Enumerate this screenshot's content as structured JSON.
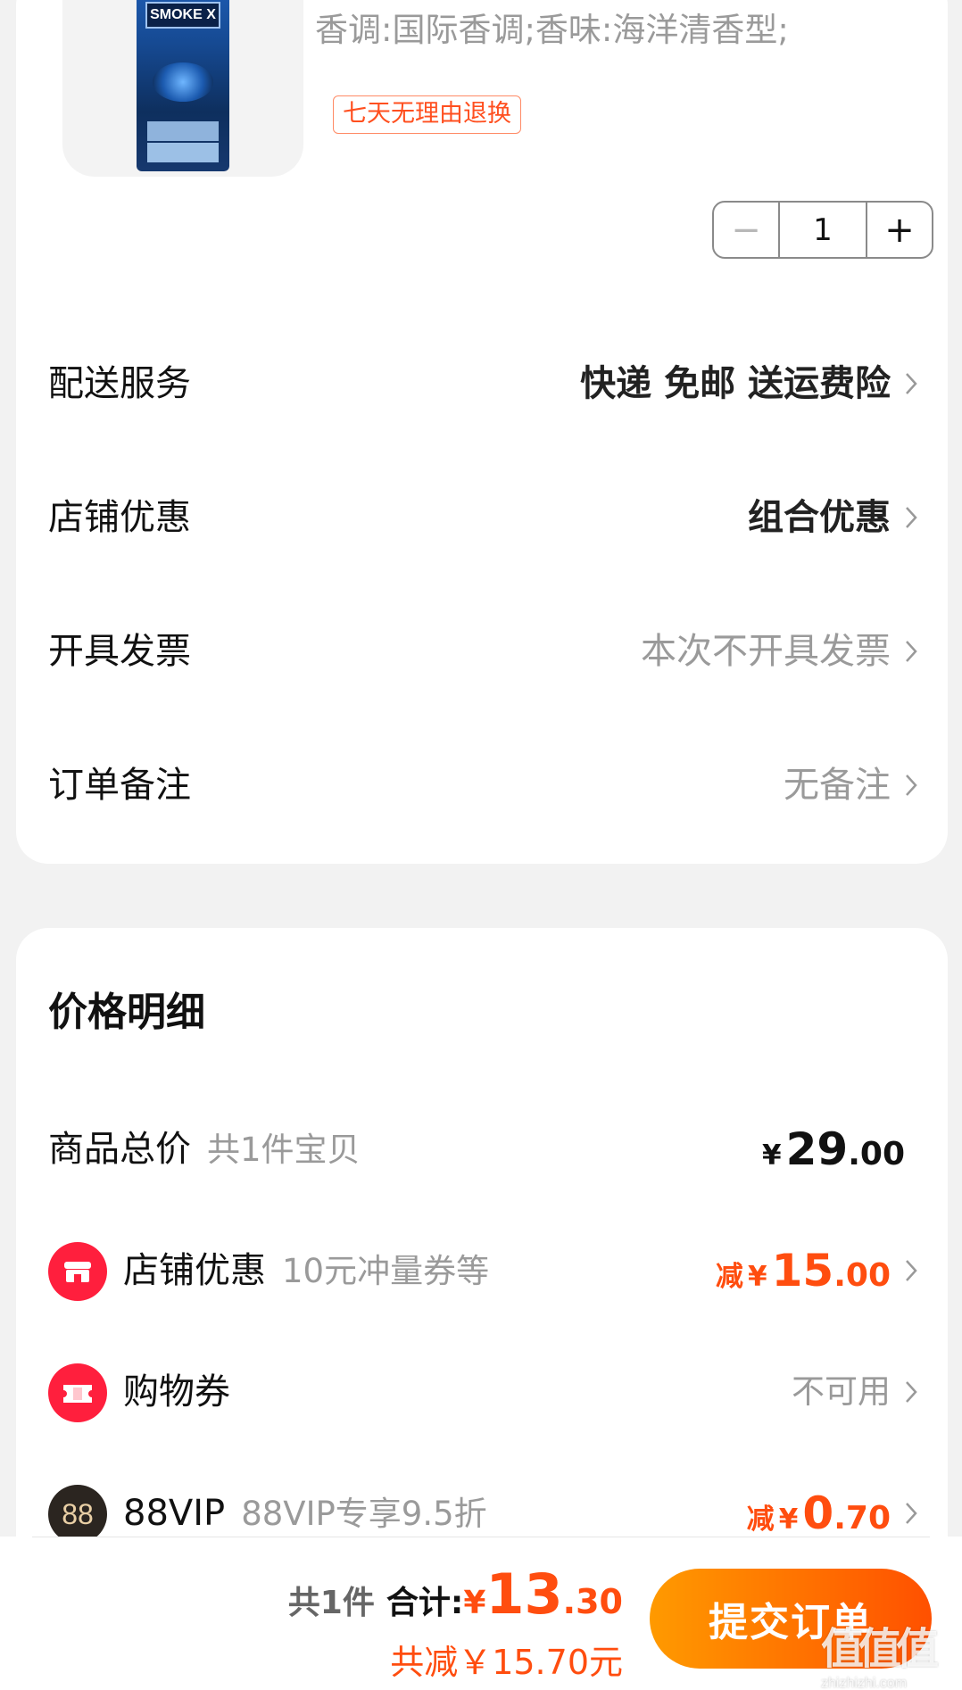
{
  "product": {
    "spec_text": "香调:国际香调;香味:海洋清香型;",
    "return_policy_tag": "七天无理由退换",
    "package_brand": "SMOKE X",
    "quantity": "1",
    "minus_symbol": "−",
    "plus_symbol": "+"
  },
  "services": [
    {
      "label": "配送服务",
      "value": "快递 免邮 送运费险",
      "style": "bold"
    },
    {
      "label": "店铺优惠",
      "value": "组合优惠",
      "style": "bold"
    },
    {
      "label": "开具发票",
      "value": "本次不开具发票",
      "style": "grey"
    },
    {
      "label": "订单备注",
      "value": "无备注",
      "style": "grey"
    }
  ],
  "price_detail": {
    "title": "价格明细",
    "total": {
      "label": "商品总价",
      "sub": "共1件宝贝",
      "currency": "¥",
      "int": "29",
      "dec": ".00"
    },
    "shop_discount": {
      "label": "店铺优惠",
      "sub": "10元冲量券等",
      "prefix": "减",
      "currency": "¥",
      "int": "15",
      "dec": ".00",
      "icon": "shop-icon"
    },
    "coupon": {
      "label": "购物券",
      "value": "不可用",
      "icon": "ticket-icon"
    },
    "vip": {
      "label": "88VIP",
      "sub": "88VIP专享9.5折",
      "prefix": "减",
      "currency": "¥",
      "int": "0",
      "dec": ".70",
      "icon_text": "88"
    }
  },
  "bottom_bar": {
    "count": "共1件",
    "total_label": "合计:",
    "currency": "¥",
    "total_int": "13",
    "total_dec": ".30",
    "saved": "共减￥15.70元",
    "submit_label": "提交订单"
  },
  "watermark": {
    "glyph": "值值值",
    "url": "zhizhizhi.com"
  },
  "colors": {
    "accent": "#ff4d0f",
    "badge_red": "#ff1f3d",
    "submit_start": "#ff9a00",
    "submit_end": "#ff5000"
  }
}
